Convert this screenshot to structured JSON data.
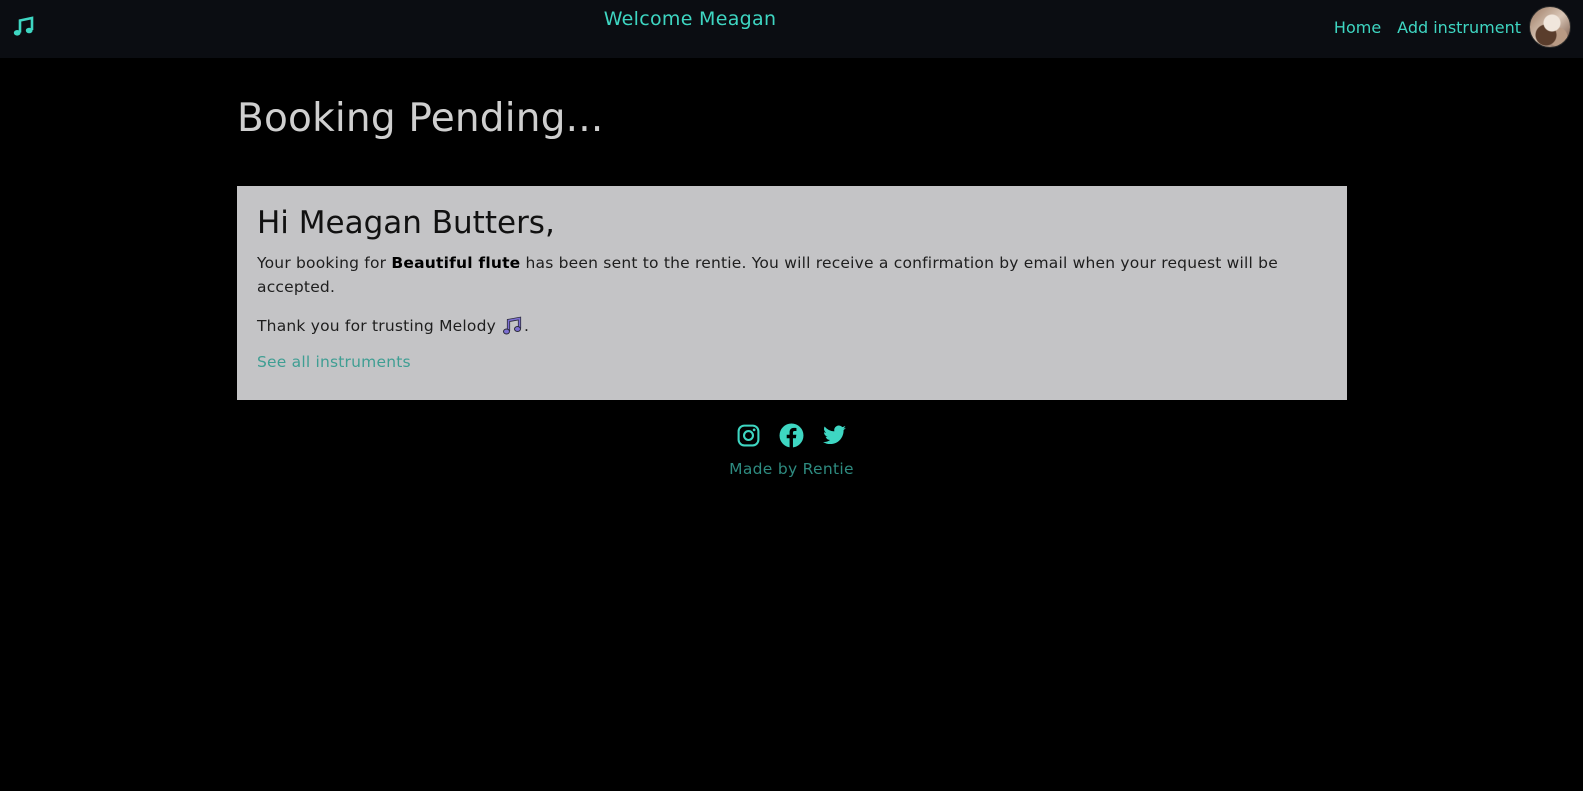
{
  "navbar": {
    "logo_icon": "music-note-icon",
    "welcome": "Welcome Meagan",
    "links": [
      {
        "label": "Home"
      },
      {
        "label": "Add instrument"
      }
    ],
    "avatar_icon": "user-avatar"
  },
  "main": {
    "title": "Booking Pending..."
  },
  "card": {
    "greeting": "Hi Meagan Butters,",
    "text_before": "Your booking for ",
    "instrument": "Beautiful flute",
    "text_after": " has been sent to the rentie. You will receive a confirmation by email when your request will be accepted.",
    "thanks": "Thank you for trusting Melody",
    "thanks_end": ".",
    "emoji_icon": "musical-notes-emoji",
    "link": "See all instruments"
  },
  "footer": {
    "icons": [
      "instagram-icon",
      "facebook-icon",
      "twitter-icon"
    ],
    "text": "Made by Rentie"
  },
  "colors": {
    "accent": "#3ed6c2",
    "navbar_bg": "#0b0d12",
    "page_bg": "#000000",
    "card_bg": "#c4c4c6",
    "link": "#3f9e93"
  }
}
